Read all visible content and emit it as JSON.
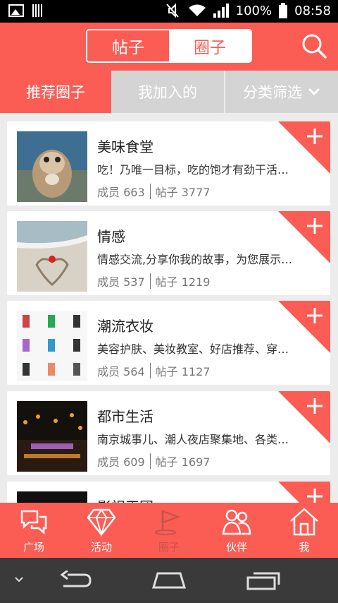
{
  "status_bar": {
    "battery": "100%",
    "time": "08:58"
  },
  "header": {
    "segments": [
      "帖子",
      "圈子"
    ],
    "active_segment": "帖子",
    "search_icon": "search-icon"
  },
  "filter_tabs": [
    {
      "label": "推荐圈子",
      "active": true
    },
    {
      "label": "我加入的",
      "active": false
    },
    {
      "label": "分类筛选",
      "active": false
    }
  ],
  "circles": [
    {
      "name": "美味食堂",
      "desc": "吃！乃唯一目标，吃的饱才有劲干活…",
      "members": "成员 663",
      "posts": "帖子 3777"
    },
    {
      "name": "情感",
      "desc": "情感交流,分享你我的故事，为您展示…",
      "members": "成员 537",
      "posts": "帖子 1219"
    },
    {
      "name": "潮流衣妆",
      "desc": "美容护肤、美妆教室、好店推荐、穿…",
      "members": "成员 564",
      "posts": "帖子 1127"
    },
    {
      "name": "都市生活",
      "desc": "南京城事儿、潮人夜店聚集地、各类…",
      "members": "成员 609",
      "posts": "帖子 1697"
    },
    {
      "name": "影视天团",
      "desc": "",
      "members": "",
      "posts": ""
    }
  ],
  "bottom_nav": [
    {
      "label": "广场",
      "icon": "chat-bubbles-icon",
      "active": false
    },
    {
      "label": "活动",
      "icon": "diamond-icon",
      "active": false
    },
    {
      "label": "圈子",
      "icon": "flag-icon",
      "active": true
    },
    {
      "label": "伙伴",
      "icon": "people-icon",
      "active": false
    },
    {
      "label": "我",
      "icon": "house-icon",
      "active": false
    }
  ],
  "colors": {
    "brand": "#fb5d55",
    "tab_inactive": "#d4d4d4"
  }
}
